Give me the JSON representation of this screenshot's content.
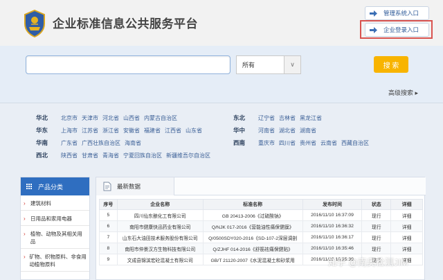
{
  "header": {
    "title": "企业标准信息公共服务平台",
    "admin_link": "管理系统入口",
    "enterprise_link": "企业登录入口"
  },
  "search": {
    "input_value": "",
    "select_value": "所有",
    "button_label": "搜 索",
    "advanced_label": "高级搜索 ▸"
  },
  "regions": [
    {
      "name": "华北",
      "items": [
        "北京市",
        "天津市",
        "河北省",
        "山西省",
        "内蒙古自治区"
      ]
    },
    {
      "name": "东北",
      "items": [
        "辽宁省",
        "吉林省",
        "黑龙江省"
      ]
    },
    {
      "name": "华东",
      "items": [
        "上海市",
        "江苏省",
        "浙江省",
        "安徽省",
        "福建省",
        "江西省",
        "山东省"
      ]
    },
    {
      "name": "华中",
      "items": [
        "河南省",
        "湖北省",
        "湖南省"
      ]
    },
    {
      "name": "华南",
      "items": [
        "广东省",
        "广西壮族自治区",
        "海南省"
      ]
    },
    {
      "name": "西南",
      "items": [
        "重庆市",
        "四川省",
        "贵州省",
        "云南省",
        "西藏自治区"
      ]
    },
    {
      "name": "西北",
      "items": [
        "陕西省",
        "甘肃省",
        "青海省",
        "宁夏回族自治区",
        "新疆维吾尔自治区"
      ]
    }
  ],
  "sidebar": {
    "title": "产品分类",
    "items": [
      "建筑材料",
      "日用品和家用电器",
      "植物、动物及其相关用品",
      "矿物、织物原料、非食用动植物原料"
    ]
  },
  "content": {
    "tab_label": "最新数据",
    "columns": [
      "序号",
      "企业名称",
      "标准名称",
      "发布时间",
      "状态",
      "详细"
    ],
    "rows": [
      [
        "5",
        "四川仙东酿化工有限公司",
        "GB 20413-2006《过硫酸钠》",
        "2016/11/10 16:37:09",
        "现行",
        "详细"
      ],
      [
        "6",
        "南阳市健康快迅药业有限公司",
        "Q/NJK 017-2016《营能油性痛保健膜》",
        "2016/11/10 16:36:32",
        "现行",
        "详细"
      ],
      [
        "7",
        "山东石大油田技术服务股份有限公司",
        "Q/0500SDY020-2016《SD-107-2深层调剖",
        "2016/11/10 16:36:17",
        "现行",
        "详细"
      ],
      [
        "8",
        "南阳市仲景汉方生物科技有限公司",
        "Q/ZJHF 014-2016《舒筋祛痛保健贴》",
        "2016/11/10 16:35:46",
        "现行",
        "详细"
      ],
      [
        "9",
        "文成县锦滨宏砼混凝土有限公司",
        "GB/T 21120-2007《水泥混凝土和砂浆用",
        "2016/11/10 16:35:39",
        "现行",
        "详细"
      ]
    ]
  },
  "watermark": "知乎 @南奥检测JIM"
}
